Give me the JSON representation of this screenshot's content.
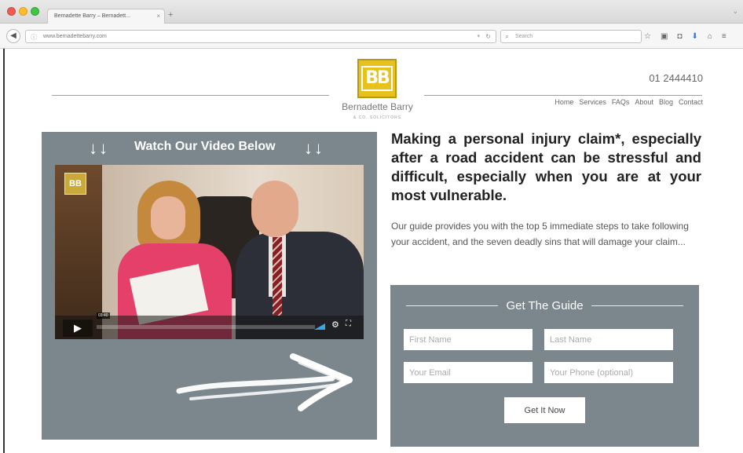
{
  "browser": {
    "tab_title": "Bernadette Barry – Bernadett...",
    "tab_close": "×",
    "new_tab": "+",
    "url": "www.bernadettebarry.com",
    "search_placeholder": "Search"
  },
  "header": {
    "logo_letters": "BB",
    "brand_name": "Bernadette Barry",
    "brand_sub": "& CO. SOLICITORS",
    "phone": "01 2444410",
    "nav": [
      "Home",
      "Services",
      "FAQs",
      "About",
      "Blog",
      "Contact"
    ]
  },
  "video_panel": {
    "arrows_left": "↓↓",
    "title": "Watch Our Video Below",
    "arrows_right": "↓↓",
    "logo_letters": "BB",
    "time": "03:40"
  },
  "content": {
    "headline": "Making a personal injury claim*, especially after a road accident can be stressful and difficult, especially when you are at your most vulnerable.",
    "subtext": "Our guide provides you with the top 5 immediate steps to take following your accident, and the seven deadly sins that will damage your claim..."
  },
  "form": {
    "title": "Get The Guide",
    "first_name_placeholder": "First Name",
    "last_name_placeholder": "Last Name",
    "email_placeholder": "Your Email",
    "phone_placeholder": "Your Phone (optional)",
    "submit_label": "Get It Now"
  },
  "colors": {
    "panel": "#7c878d",
    "logo": "#e8c21c",
    "accent_blue": "#2a7be0"
  }
}
